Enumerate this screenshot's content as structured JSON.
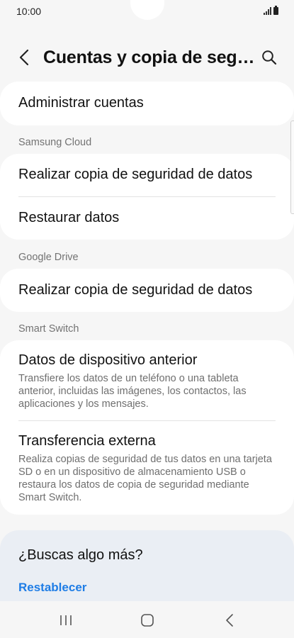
{
  "status_bar": {
    "time": "10:00"
  },
  "header": {
    "title": "Cuentas y copia de seguridad",
    "back_icon": "chevron-left-icon",
    "search_icon": "search-icon"
  },
  "items": {
    "manage_accounts": "Administrar cuentas",
    "samsung_backup": "Realizar copia de seguridad de datos",
    "restore_data": "Restaurar datos",
    "google_backup": "Realizar copia de seguridad de datos",
    "previous_device": {
      "label": "Datos de dispositivo anterior",
      "description": "Transfiere los datos de un teléfono o una tableta anterior, incluidas las imágenes, los contactos, las aplicaciones y los mensajes."
    },
    "external_transfer": {
      "label": "Transferencia externa",
      "description": "Realiza copias de seguridad de tus datos en una tarjeta SD o en un dispositivo de almacenamiento USB o restaura los datos de copia de seguridad mediante Smart Switch."
    }
  },
  "sections": {
    "samsung_cloud": "Samsung Cloud",
    "google_drive": "Google Drive",
    "smart_switch": "Smart Switch"
  },
  "more": {
    "title": "¿Buscas algo más?",
    "reset_link": "Restablecer"
  },
  "colors": {
    "background": "#f6f6f6",
    "card": "#ffffff",
    "accent_link": "#1f7de6",
    "more_card": "#eaeef4"
  }
}
